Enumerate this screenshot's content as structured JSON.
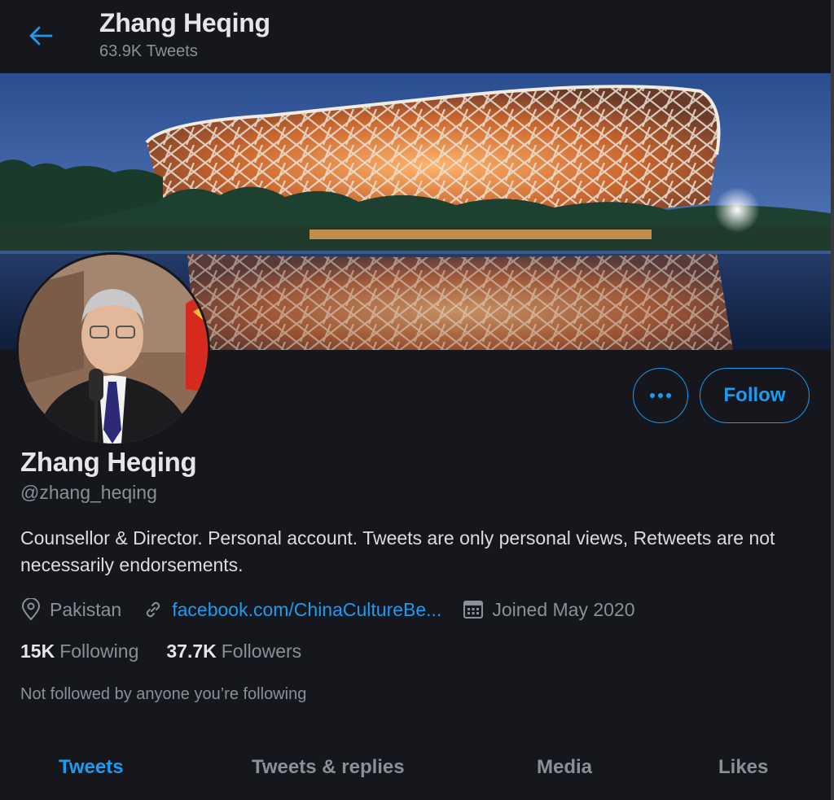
{
  "header": {
    "name": "Zhang Heqing",
    "tweet_count": "63.9K Tweets"
  },
  "actions": {
    "follow_label": "Follow"
  },
  "profile": {
    "name": "Zhang Heqing",
    "handle": "@zhang_heqing",
    "bio": "Counsellor & Director. Personal account. Tweets are only personal views, Retweets are not necessarily endorsements.",
    "location": "Pakistan",
    "website": "facebook.com/ChinaCultureBe...",
    "joined": "Joined May 2020",
    "following_count": "15K",
    "following_label": "Following",
    "followers_count": "37.7K",
    "followers_label": "Followers",
    "mutuals_text": "Not followed by anyone you’re following"
  },
  "tabs": [
    {
      "label": "Tweets",
      "active": true
    },
    {
      "label": "Tweets & replies",
      "active": false
    },
    {
      "label": "Media",
      "active": false
    },
    {
      "label": "Likes",
      "active": false
    }
  ],
  "colors": {
    "accent": "#1d9bf0",
    "background": "#15171c",
    "text_primary": "#e6e6e6",
    "text_secondary": "#8b9096"
  },
  "icons": [
    "back-arrow-icon",
    "more-options-icon",
    "location-pin-icon",
    "link-icon",
    "calendar-icon"
  ]
}
